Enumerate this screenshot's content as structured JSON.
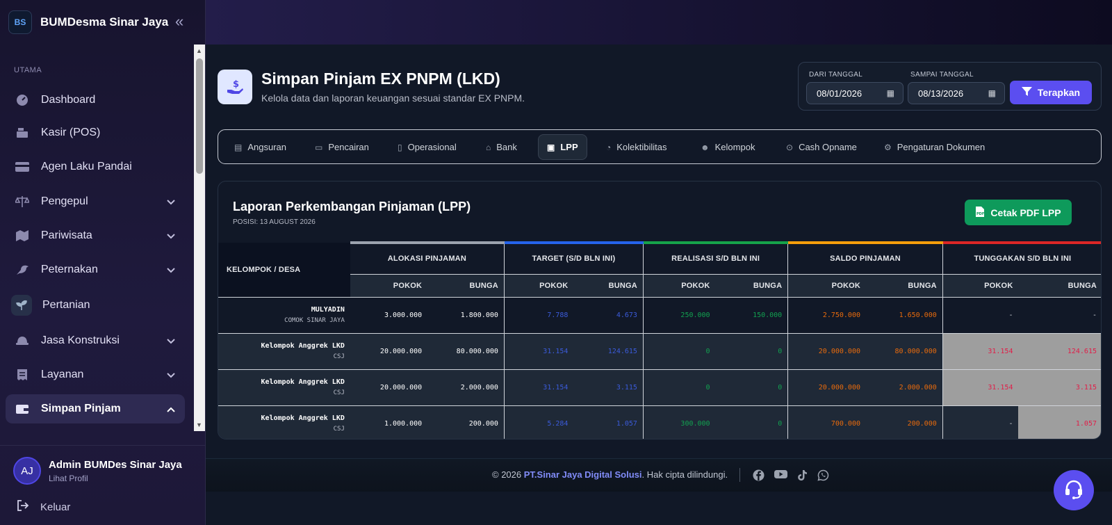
{
  "brand": {
    "name": "BUMDesma Sinar Jaya",
    "logo_text": "BS"
  },
  "sidebar": {
    "section": "UTAMA",
    "items": [
      {
        "label": "Dashboard"
      },
      {
        "label": "Kasir (POS)"
      },
      {
        "label": "Agen Laku Pandai"
      },
      {
        "label": "Pengepul"
      },
      {
        "label": "Pariwisata"
      },
      {
        "label": "Peternakan"
      },
      {
        "label": "Pertanian"
      },
      {
        "label": "Jasa Konstruksi"
      },
      {
        "label": "Layanan"
      },
      {
        "label": "Simpan Pinjam"
      }
    ]
  },
  "user": {
    "initials": "AJ",
    "name": "Admin BUMDes Sinar Jaya",
    "sub": "Lihat Profil",
    "logout": "Keluar"
  },
  "page": {
    "title": "Simpan Pinjam EX PNPM (LKD)",
    "subtitle": "Kelola data dan laporan keuangan sesuai standar EX PNPM."
  },
  "filter": {
    "from_label": "DARI TANGGAL",
    "from_value": "08/01/2026",
    "to_label": "SAMPAI TANGGAL",
    "to_value": "08/13/2026",
    "apply": "Terapkan"
  },
  "tabs": [
    "Angsuran",
    "Pencairan",
    "Operasional",
    "Bank",
    "LPP",
    "Kolektibilitas",
    "Kelompok",
    "Cash Opname",
    "Pengaturan Dokumen"
  ],
  "report": {
    "title": "Laporan Perkembangan Pinjaman (LPP)",
    "position": "POSISI: 13 AUGUST 2026",
    "pdf_button": "Cetak PDF LPP",
    "col_kelompok": "KELOMPOK / DESA",
    "groups": [
      "ALOKASI PINJAMAN",
      "TARGET (S/D BLN INI)",
      "REALISASI S/D BLN INI",
      "SALDO PINJAMAN",
      "TUNGGAKAN S/D BLN INI"
    ],
    "sub_pokok": "POKOK",
    "sub_bunga": "BUNGA",
    "rows": [
      {
        "name": "MULYADIN",
        "desa": "COMOK SINAR JAYA",
        "alokasi_pokok": "3.000.000",
        "alokasi_bunga": "1.800.000",
        "target_pokok": "7.788",
        "target_bunga": "4.673",
        "real_pokok": "250.000",
        "real_bunga": "150.000",
        "saldo_pokok": "2.750.000",
        "saldo_bunga": "1.650.000",
        "tung_pokok": "-",
        "tung_bunga": "-"
      },
      {
        "name": "Kelompok Anggrek LKD",
        "desa": "CSJ",
        "alokasi_pokok": "20.000.000",
        "alokasi_bunga": "80.000.000",
        "target_pokok": "31.154",
        "target_bunga": "124.615",
        "real_pokok": "0",
        "real_bunga": "0",
        "saldo_pokok": "20.000.000",
        "saldo_bunga": "80.000.000",
        "tung_pokok": "31.154",
        "tung_bunga": "124.615"
      },
      {
        "name": "Kelompok Anggrek LKD",
        "desa": "CSJ",
        "alokasi_pokok": "20.000.000",
        "alokasi_bunga": "2.000.000",
        "target_pokok": "31.154",
        "target_bunga": "3.115",
        "real_pokok": "0",
        "real_bunga": "0",
        "saldo_pokok": "20.000.000",
        "saldo_bunga": "2.000.000",
        "tung_pokok": "31.154",
        "tung_bunga": "3.115"
      },
      {
        "name": "Kelompok Anggrek LKD",
        "desa": "CSJ",
        "alokasi_pokok": "1.000.000",
        "alokasi_bunga": "200.000",
        "target_pokok": "5.284",
        "target_bunga": "1.057",
        "real_pokok": "300.000",
        "real_bunga": "0",
        "saldo_pokok": "700.000",
        "saldo_bunga": "200.000",
        "tung_pokok": "-",
        "tung_bunga": "1.057"
      }
    ]
  },
  "footer": {
    "prefix": "© 2026 ",
    "company": "PT.Sinar Jaya Digital Solusi",
    "suffix": ". Hak cipta dilindungi."
  },
  "colors": {
    "accent": "#5b4ef0",
    "pdf_green": "#0e9a5b",
    "target_blue": "#3b5bdb",
    "realisasi_green": "#12a150",
    "saldo_orange": "#ea6b0c",
    "tunggakan_red": "#e11d48"
  },
  "icons": [
    "speedometer-icon",
    "cash-register-icon",
    "credit-card-icon",
    "scale-icon",
    "map-icon",
    "bird-icon",
    "sprout-icon",
    "helmet-icon",
    "receipt-icon",
    "wallet-icon",
    "logout-icon",
    "filter-icon",
    "pdf-icon",
    "facebook-icon",
    "youtube-icon",
    "tiktok-icon",
    "whatsapp-icon",
    "headset-icon"
  ]
}
